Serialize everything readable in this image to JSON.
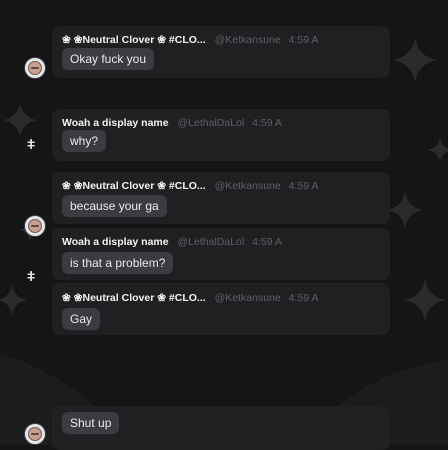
{
  "messages": [
    {
      "author": "❀ ❀Neutral Clover ❀ #CLO...",
      "username": "@Ketkansune",
      "time": "4:59 A",
      "text": "Okay fuck you",
      "avatar_icon": "clover-avatar-icon"
    },
    {
      "author": "Woah a display name",
      "username": "@LethalDaLol",
      "time": "4:59 A",
      "text": "why?",
      "avatar_icon": "stick-figure-icon"
    },
    {
      "author": "❀ ❀Neutral Clover ❀ #CLO...",
      "username": "@Ketkansune",
      "time": "4:59 A",
      "text": "because your ga",
      "avatar_icon": "clover-avatar-icon"
    },
    {
      "author": "Woah a display name",
      "username": "@LethalDaLol",
      "time": "4:59 A",
      "text": "is that a problem?",
      "avatar_icon": "stick-figure-icon"
    },
    {
      "author": "❀ ❀Neutral Clover ❀ #CLO...",
      "username": "@Ketkansune",
      "time": "4:59 A",
      "text": "Gay",
      "avatar_icon": "clover-avatar-icon"
    },
    {
      "author": "",
      "username": "",
      "time": "",
      "text": "Shut up",
      "avatar_icon": "clover-avatar-icon"
    }
  ],
  "colors": {
    "background": "#141516",
    "bubble": "#202123",
    "message_pill": "#3a3c41",
    "author_name": "#f2f3f5",
    "username_time": "#5c5f66",
    "clover_accent": "#3ba55c"
  }
}
